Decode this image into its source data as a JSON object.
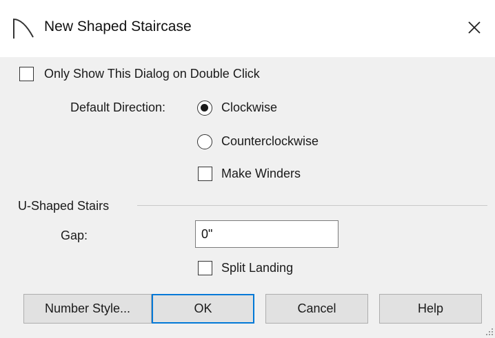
{
  "window": {
    "title": "New Shaped Staircase",
    "icon": "arch-stair-icon",
    "close_icon": "close-icon"
  },
  "options": {
    "only_show_dialog": {
      "label": "Only Show This Dialog on Double Click",
      "checked": false
    },
    "default_direction": {
      "label": "Default Direction:",
      "choices": [
        {
          "label": "Clockwise",
          "selected": true
        },
        {
          "label": "Counterclockwise",
          "selected": false
        }
      ]
    },
    "make_winders": {
      "label": "Make Winders",
      "checked": false
    }
  },
  "u_shaped": {
    "group_label": "U-Shaped Stairs",
    "gap_label": "Gap:",
    "gap_value": "0\"",
    "split_landing": {
      "label": "Split Landing",
      "checked": false
    }
  },
  "buttons": {
    "number_style": "Number Style...",
    "ok": "OK",
    "cancel": "Cancel",
    "help": "Help"
  },
  "colors": {
    "background": "#f0f0f0",
    "titlebar": "#ffffff",
    "default_button_border": "#0078d7",
    "button_face": "#e1e1e1"
  }
}
